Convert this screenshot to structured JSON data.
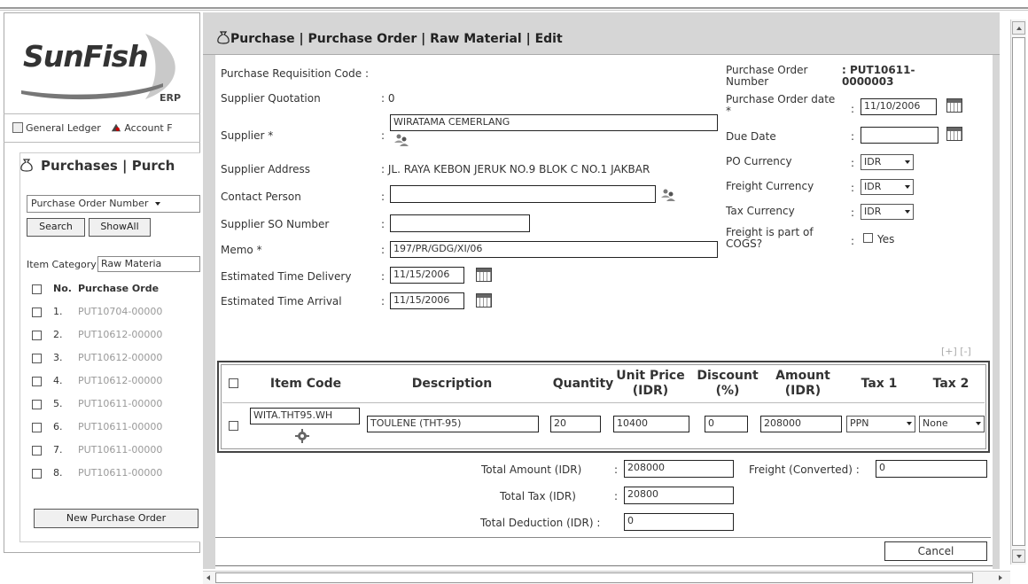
{
  "background": {
    "logo": {
      "name": "SunFish",
      "sub": "ERP"
    },
    "nav": {
      "general_ledger": "General Ledger",
      "account": "Account F"
    },
    "panel_title": "Purchases | Purch",
    "search_select": "Purchase Order Number",
    "search_btn": "Search",
    "showall_btn": "ShowAll",
    "item_category_label": "Item Category",
    "item_category_value": "Raw Materia",
    "table": {
      "col_no": "No.",
      "col_code": "Purchase Orde",
      "rows": [
        {
          "no": "1.",
          "code": "PUT10704-00000"
        },
        {
          "no": "2.",
          "code": "PUT10612-00000"
        },
        {
          "no": "3.",
          "code": "PUT10612-00000"
        },
        {
          "no": "4.",
          "code": "PUT10612-00000"
        },
        {
          "no": "5.",
          "code": "PUT10611-00000"
        },
        {
          "no": "6.",
          "code": "PUT10611-00000"
        },
        {
          "no": "7.",
          "code": "PUT10611-00000"
        },
        {
          "no": "8.",
          "code": "PUT10611-00000"
        }
      ]
    },
    "new_po_btn": "New Purchase Order"
  },
  "modal": {
    "title": "Purchase | Purchase Order | Raw Material | Edit",
    "left": {
      "pr_code_label": "Purchase Requisition Code :",
      "supplier_quotation_label": "Supplier Quotation",
      "supplier_quotation_value": ": 0",
      "supplier_label": "Supplier *",
      "supplier_value": "WIRATAMA CEMERLANG",
      "supplier_address_label": "Supplier Address",
      "supplier_address_value": ": JL. RAYA KEBON JERUK NO.9 BLOK C NO.1 JAKBAR",
      "contact_person_label": "Contact Person",
      "contact_person_value": "",
      "supplier_so_label": "Supplier SO Number",
      "supplier_so_value": "",
      "memo_label": "Memo *",
      "memo_value": "197/PR/GDG/XI/06",
      "etd_label": "Estimated Time Delivery",
      "etd_value": "11/15/2006",
      "eta_label": "Estimated Time Arrival",
      "eta_value": "11/15/2006",
      "colon": ":"
    },
    "right": {
      "po_number_label_1": "Purchase Order",
      "po_number_label_2": "Number",
      "po_number_value_1": ": PUT10611-",
      "po_number_value_2": "0000003",
      "po_date_label_1": "Purchase Order date",
      "po_date_label_2": "*",
      "po_date_value": "11/10/2006",
      "due_date_label": "Due Date",
      "due_date_value": "",
      "po_currency_label": "PO Currency",
      "po_currency_value": "IDR",
      "freight_currency_label": "Freight Currency",
      "freight_currency_value": "IDR",
      "tax_currency_label": "Tax Currency",
      "tax_currency_value": "IDR",
      "freight_cogs_label_1": "Freight is part of",
      "freight_cogs_label_2": "COGS?",
      "freight_cogs_yes": "Yes"
    },
    "plusminus": "[+] [-]",
    "items": {
      "headers": {
        "item_code": "Item Code",
        "description": "Description",
        "quantity": "Quantity",
        "unit_price_1": "Unit Price",
        "unit_price_2": "(IDR)",
        "discount_1": "Discount",
        "discount_2": "(%)",
        "amount_1": "Amount",
        "amount_2": "(IDR)",
        "tax1": "Tax 1",
        "tax2": "Tax 2"
      },
      "row": {
        "item_code": "WITA.THT95.WH",
        "description": "TOULENE (THT-95)",
        "quantity": "20",
        "unit_price": "10400",
        "discount": "0",
        "amount": "208000",
        "tax1": "PPN",
        "tax2": "None"
      }
    },
    "totals": {
      "total_amount_label": "Total Amount (IDR)",
      "total_amount_value": "208000",
      "total_tax_label": "Total Tax (IDR)",
      "total_tax_value": "20800",
      "total_deduction_label": "Total Deduction (IDR) :",
      "total_deduction_value": "0",
      "freight_label": "Freight (Converted) :",
      "freight_value": "0"
    },
    "cancel_btn": "Cancel"
  }
}
